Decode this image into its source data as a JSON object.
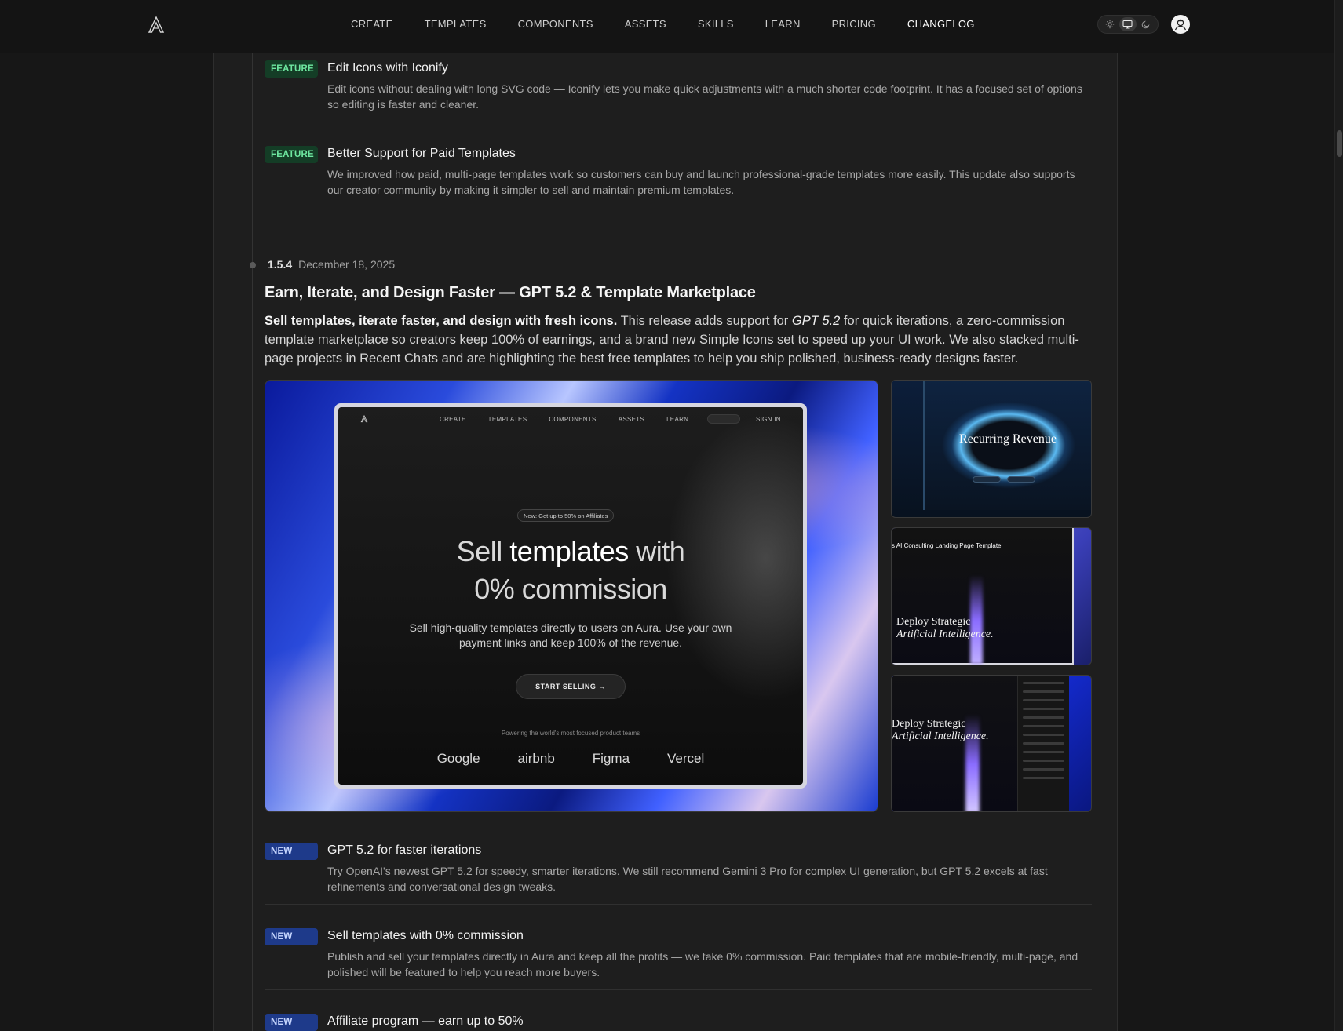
{
  "header": {
    "nav": [
      {
        "label": "CREATE"
      },
      {
        "label": "TEMPLATES"
      },
      {
        "label": "COMPONENTS"
      },
      {
        "label": "ASSETS"
      },
      {
        "label": "SKILLS"
      },
      {
        "label": "LEARN"
      },
      {
        "label": "PRICING"
      },
      {
        "label": "CHANGELOG"
      }
    ],
    "theme_options": [
      "sun-icon",
      "monitor-icon",
      "moon-icon"
    ],
    "theme_selected": "monitor-icon"
  },
  "previous_items": [
    {
      "badge": "FEATURE",
      "title": "Edit Icons with Iconify",
      "desc": "Edit icons without dealing with long SVG code — Iconify lets you make quick adjustments with a much shorter code footprint. It has a focused set of options so editing is faster and cleaner."
    },
    {
      "badge": "FEATURE",
      "title": "Better Support for Paid Templates",
      "desc": "We improved how paid, multi-page templates work so customers can buy and launch professional-grade templates more easily. This update also supports our creator community by making it simpler to sell and maintain premium templates."
    }
  ],
  "release": {
    "version": "1.5.4",
    "date": "December 18, 2025",
    "title": "Earn, Iterate, and Design Faster — GPT 5.2 & Template Marketplace",
    "summary_strong": "Sell templates, iterate faster, and design with fresh icons.",
    "summary_pre": " This release adds support for ",
    "summary_em": "GPT 5.2",
    "summary_post": " for quick iterations, a zero-commission template marketplace so creators keep 100% of earnings, and a brand new Simple Icons set to speed up your UI work. We also stacked multi-page projects in Recent Chats and are highlighting the best free templates to help you ship polished, business-ready designs faster."
  },
  "hero_preview": {
    "nav": [
      "CREATE",
      "TEMPLATES",
      "COMPONENTS",
      "ASSETS",
      "LEARN"
    ],
    "signin": "SIGN IN",
    "pill": "New: Get up to 50% on Affiliates",
    "headline_1a": "Sell ",
    "headline_1b": "templates",
    "headline_1c": " with",
    "headline_2": "0% commission",
    "sub": "Sell high-quality templates directly to users on Aura. Use your own payment links and keep 100% of the revenue.",
    "cta": "START SELLING →",
    "powered": "Powering the world's most focused product teams",
    "logos": [
      "Google",
      "airbnb",
      "Figma",
      "Vercel"
    ]
  },
  "thumbs": {
    "t1_text": "Recurring Revenue",
    "t2_caption": "s AI Consulting Landing Page Template",
    "t2_heading_1": "Deploy Strategic",
    "t2_heading_2": "Artificial Intelligence.",
    "t3_heading_1": "Deploy Strategic",
    "t3_heading_2": "Artificial Intelligence."
  },
  "new_items": [
    {
      "badge": "NEW",
      "title": "GPT 5.2 for faster iterations",
      "desc": "Try OpenAI's newest GPT 5.2 for speedy, smarter iterations. We still recommend Gemini 3 Pro for complex UI generation, but GPT 5.2 excels at fast refinements and conversational design tweaks."
    },
    {
      "badge": "NEW",
      "title": "Sell templates with 0% commission",
      "desc": "Publish and sell your templates directly in Aura and keep all the profits — we take 0% commission. Paid templates that are mobile-friendly, multi-page, and polished will be featured to help you reach more buyers."
    },
    {
      "badge": "NEW",
      "title": "Affiliate program — earn up to 50%",
      "desc": ""
    }
  ],
  "colors": {
    "feature_badge_bg": "#143d26",
    "feature_badge_text": "#6ee7a0",
    "new_badge_bg": "#1e3a8a",
    "new_badge_text": "#c7d7ff"
  }
}
